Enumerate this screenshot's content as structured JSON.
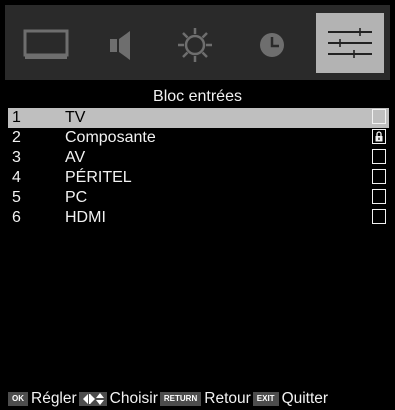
{
  "tabs": [
    {
      "icon": "picture-icon",
      "active": false
    },
    {
      "icon": "sound-icon",
      "active": false
    },
    {
      "icon": "settings-icon",
      "active": false
    },
    {
      "icon": "clock-icon",
      "active": false
    },
    {
      "icon": "options-sliders-icon",
      "active": true
    }
  ],
  "menu": {
    "title": "Bloc entrées",
    "items": [
      {
        "num": "1",
        "name": "TV",
        "locked": false,
        "selected": true
      },
      {
        "num": "2",
        "name": "Composante",
        "locked": true,
        "selected": false
      },
      {
        "num": "3",
        "name": "AV",
        "locked": false,
        "selected": false
      },
      {
        "num": "4",
        "name": "PÉRITEL",
        "locked": false,
        "selected": false
      },
      {
        "num": "5",
        "name": "PC",
        "locked": false,
        "selected": false
      },
      {
        "num": "6",
        "name": "HDMI",
        "locked": false,
        "selected": false
      }
    ]
  },
  "help": {
    "ok_key": "OK",
    "ok_label": "Régler",
    "nav_label": "Choisir",
    "return_key": "RETURN",
    "return_label": "Retour",
    "exit_key": "EXIT",
    "exit_label": "Quitter"
  },
  "colors": {
    "background": "#000000",
    "tabbar": "#2a2a2a",
    "active_tab": "#b3b3b3",
    "selected_row": "#bfbfbf",
    "text": "#f2f2f2"
  }
}
